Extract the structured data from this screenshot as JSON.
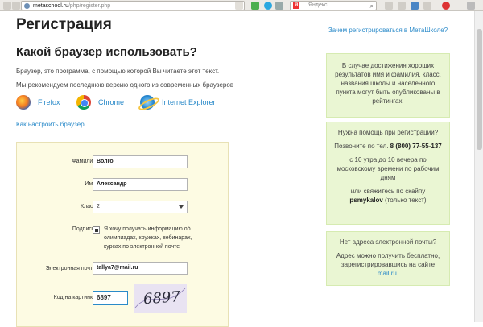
{
  "browser": {
    "url_host": "metaschool.ru",
    "url_path": "/php/register.php",
    "search_placeholder": "Яндекс",
    "search_logo": "Я"
  },
  "page": {
    "title": "Регистрация",
    "section_title": "Какой браузер использовать?",
    "text1": "Браузер, это программа, с помощью которой Вы читаете этот текст.",
    "text2": "Мы рекомендуем последнюю версию одного из современных браузеров",
    "browsers": [
      {
        "label": "Firefox",
        "icon": "firefox-icon"
      },
      {
        "label": "Chrome",
        "icon": "chrome-icon"
      },
      {
        "label": "Internet Explorer",
        "icon": "internet-explorer-icon"
      }
    ],
    "howto_link": "Как настроить браузер"
  },
  "form": {
    "surname_label": "Фамилия:",
    "surname_value": "Волго",
    "name_label": "Имя:",
    "name_value": "Александр",
    "class_label": "Класс:",
    "class_value": "2",
    "subscribe_label": "Подписка",
    "subscribe_checked": true,
    "subscribe_text": "Я хочу получать информацию об олимпиадах, кружках, вебинарах, курсах по электронной почте",
    "email_label": "Электронная почта:",
    "email_value": "tallya7@mail.ru",
    "captcha_label": "Код на картинке:",
    "captcha_value": "6897",
    "captcha_image_text": "6897"
  },
  "sidebar": {
    "why_link": "Зачем регистрироваться в МетаШколе?",
    "box1": "В случае достижения хороших результатов имя и фамилия, класс, названия школы и населенного пункта могут быть опубликованы в рейтингах.",
    "box2": {
      "heading": "Нужна помощь при регистрации?",
      "call": "Позвоните по тел.",
      "phone": "8 (800) 77-55-137",
      "hours": "с 10 утра до 10 вечера по московскому времени по рабочим дням",
      "skype_pre": "или свяжитесь по скайпу",
      "skype": "psmykalov",
      "skype_post": "(только текст)"
    },
    "box3": {
      "heading": "Нет адреса электронной почты?",
      "text": "Адрес можно получить бесплатно, зарегистрировавшись на сайте",
      "link": "mail.ru",
      "dot": "."
    }
  }
}
